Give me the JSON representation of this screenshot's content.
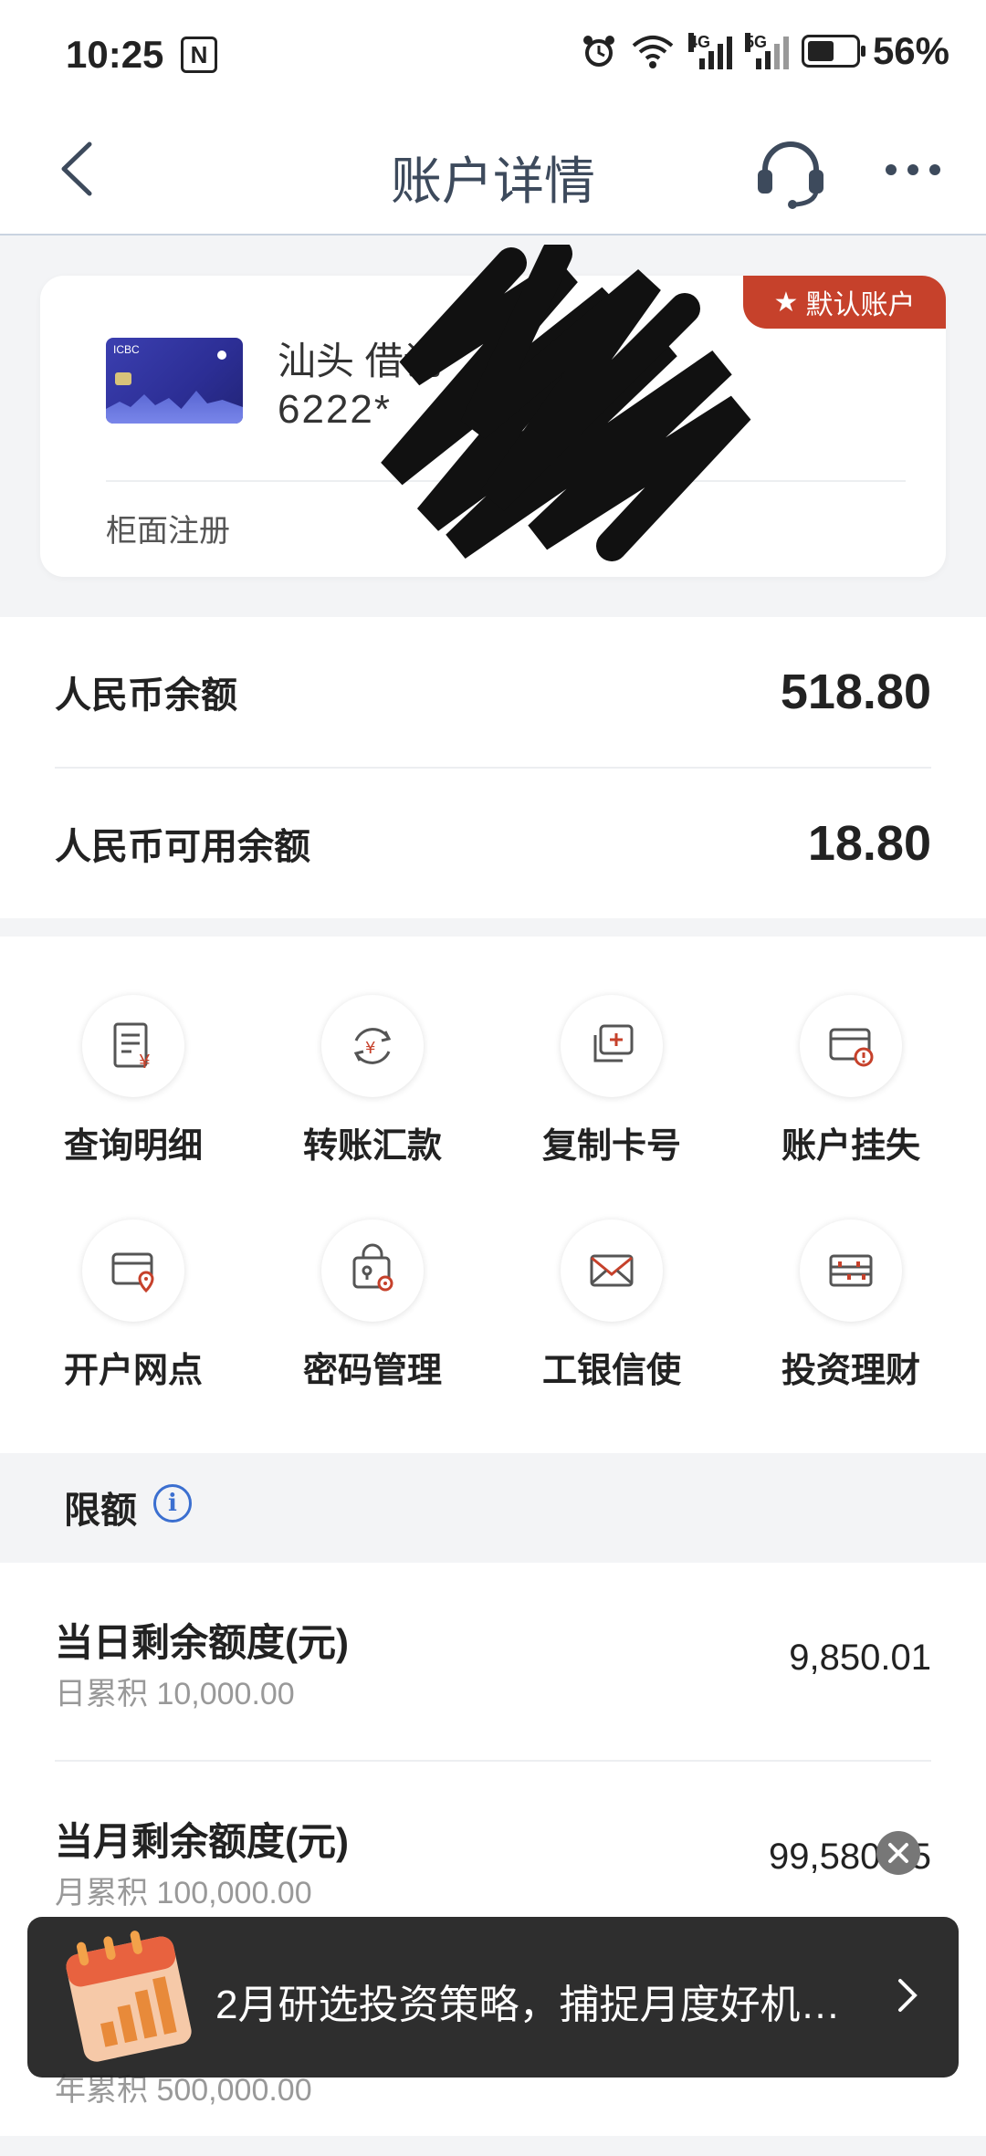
{
  "status_bar": {
    "time": "10:25",
    "nfc": "N",
    "net_4g": "4G",
    "net_5g": "5G",
    "battery": "56%"
  },
  "header": {
    "title": "账户详情"
  },
  "account_card": {
    "badge": "默认账户",
    "card_logo": "ICBC",
    "name": "汕头 借记",
    "number": "6222*",
    "registered_at": "柜面注册"
  },
  "balances": [
    {
      "label": "人民币余额",
      "value": "518.80"
    },
    {
      "label": "人民币可用余额",
      "value": "18.80"
    }
  ],
  "actions": [
    {
      "label": "查询明细",
      "icon": "statement-icon"
    },
    {
      "label": "转账汇款",
      "icon": "transfer-icon"
    },
    {
      "label": "复制卡号",
      "icon": "copy-card-icon"
    },
    {
      "label": "账户挂失",
      "icon": "report-loss-icon"
    },
    {
      "label": "开户网点",
      "icon": "branch-location-icon"
    },
    {
      "label": "密码管理",
      "icon": "password-icon"
    },
    {
      "label": "工银信使",
      "icon": "envelope-icon"
    },
    {
      "label": "投资理财",
      "icon": "abacus-icon"
    }
  ],
  "limits": {
    "title": "限额",
    "rows": [
      {
        "label": "当日剩余额度(元)",
        "sub": "日累积 10,000.00",
        "value": "9,850.01"
      },
      {
        "label": "当月剩余额度(元)",
        "sub": "月累积 100,000.00",
        "value": "99,580.75"
      },
      {
        "label": "",
        "sub": "年累积 500,000.00",
        "value": ""
      }
    ]
  },
  "promo": {
    "text": "2月研选投资策略，捕捉月度好机…"
  },
  "colors": {
    "accent_red": "#c6412b",
    "info_blue": "#3b6fd0",
    "title_gray": "#3d4a5c"
  }
}
